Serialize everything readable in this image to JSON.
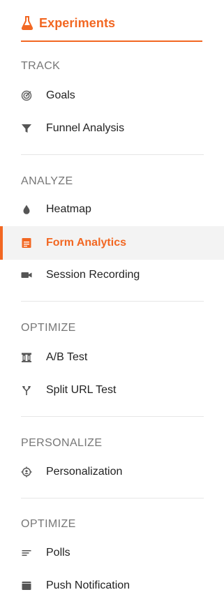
{
  "header": {
    "title": "Experiments",
    "icon": "flask-icon"
  },
  "colors": {
    "accent": "#f26722",
    "section": "#777777",
    "text": "#222222",
    "active_bg": "#f3f3f3"
  },
  "sections": [
    {
      "title": "TRACK",
      "items": [
        {
          "label": "Goals",
          "icon": "target-icon"
        },
        {
          "label": "Funnel Analysis",
          "icon": "funnel-icon"
        }
      ]
    },
    {
      "title": "ANALYZE",
      "items": [
        {
          "label": "Heatmap",
          "icon": "drop-icon"
        },
        {
          "label": "Form Analytics",
          "icon": "form-icon",
          "active": true
        },
        {
          "label": "Session Recording",
          "icon": "video-camera-icon"
        }
      ]
    },
    {
      "title": "OPTIMIZE",
      "items": [
        {
          "label": "A/B Test",
          "icon": "ab-test-icon"
        },
        {
          "label": "Split URL Test",
          "icon": "split-arrows-icon"
        }
      ]
    },
    {
      "title": "PERSONALIZE",
      "items": [
        {
          "label": "Personalization",
          "icon": "crosshair-person-icon"
        }
      ]
    },
    {
      "title": "OPTIMIZE",
      "items": [
        {
          "label": "Polls",
          "icon": "list-icon"
        },
        {
          "label": "Push Notification",
          "icon": "browser-window-icon"
        }
      ]
    }
  ]
}
